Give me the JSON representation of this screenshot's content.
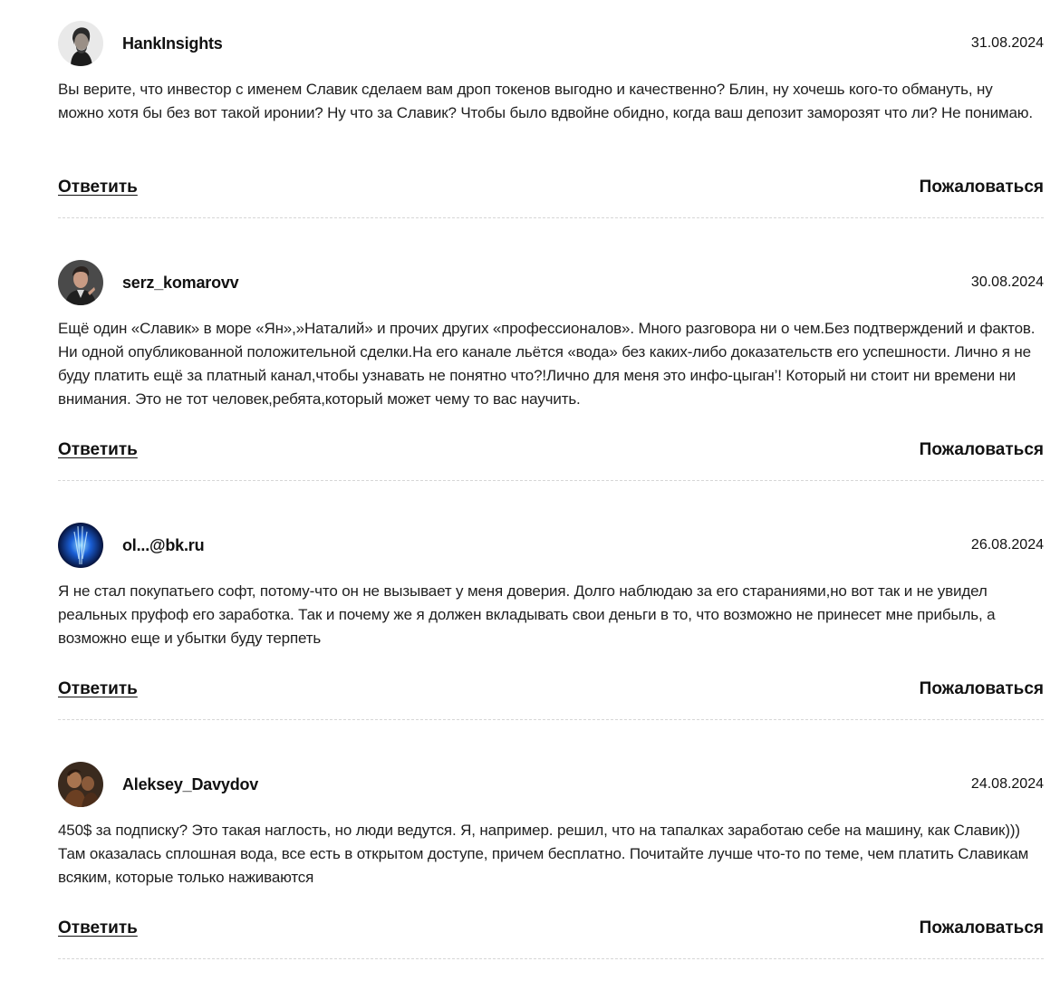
{
  "comments": [
    {
      "author": "HankInsights",
      "date": "31.08.2024",
      "avatar_icon": "user-photo-icon",
      "text": "Вы верите, что инвестор с именем Славик сделаем вам дроп токенов выгодно и качественно? Блин, ну хочешь кого-то обмануть, ну можно хотя бы без вот такой иронии? Ну что за Славик? Чтобы было вдвойне обидно, когда ваш депозит заморозят что ли? Не понимаю.",
      "reply_label": "Ответить",
      "report_label": "Пожаловаться"
    },
    {
      "author": "serz_komarovv",
      "date": "30.08.2024",
      "avatar_icon": "user-photo-icon",
      "text": "Ещё один «Славик» в море «Ян»,»Наталий» и прочих других «профессионалов». Много разговора ни о чем.Без подтверждений и фактов. Ни одной опубликованной положительной сделки.На его канале льётся «вода» без каких-либо доказательств его успешности. Лично я не буду платить ещё за платный канал,чтобы узнавать не понятно что?!Лично для меня это инфо-цыган’! Который ни стоит ни времени ни внимания. Это не тот человек,ребята,который может чему то вас научить.",
      "reply_label": "Ответить",
      "report_label": "Пожаловаться"
    },
    {
      "author": "ol...@bk.ru",
      "date": "26.08.2024",
      "avatar_icon": "user-photo-icon",
      "text": "Я не стал покупатьего софт, потому-что он не вызывает у меня доверия. Долго наблюдаю за его стараниями,но вот так и не увидел реальных пруфоф его заработка. Так и почему же я должен вкладывать свои деньги в то, что возможно не принесет мне прибыль, а возможно еще и убытки буду терпеть",
      "reply_label": "Ответить",
      "report_label": "Пожаловаться"
    },
    {
      "author": "Aleksey_Davydov",
      "date": "24.08.2024",
      "avatar_icon": "user-photo-icon",
      "text": "450$ за подписку? Это такая наглость, но люди ведутся. Я, например. решил, что на тапалках заработаю себе на машину, как Славик))) Там оказалась сплошная вода, все есть в открытом доступе, причем бесплатно. Почитайте лучше что-то по теме, чем платить Славикам всяким, которые только наживаются",
      "reply_label": "Ответить",
      "report_label": "Пожаловаться"
    }
  ]
}
